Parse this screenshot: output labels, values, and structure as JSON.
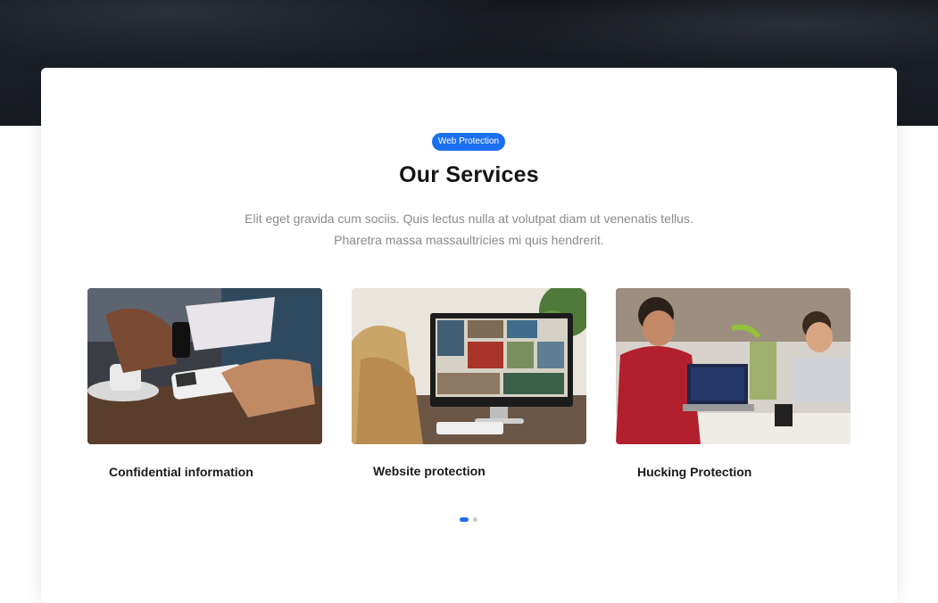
{
  "section": {
    "badge": "Web Protection",
    "title": "Our Services",
    "subtitle_line1": "Elit eget gravida cum sociis. Quis lectus nulla at volutpat diam ut venenatis tellus.",
    "subtitle_line2": "Pharetra massa massaultricies mi quis hendrerit."
  },
  "services": [
    {
      "label": "Confidential information",
      "image": "payment-terminal-photo"
    },
    {
      "label": "Website protection",
      "image": "computer-monitor-photo"
    },
    {
      "label": "Hucking Protection",
      "image": "people-with-laptops-photo"
    }
  ],
  "carousel": {
    "active_index": 0,
    "total": 2
  },
  "colors": {
    "accent": "#1d6ff2",
    "hero_bg": "#171a21",
    "title": "#141414",
    "subtitle": "#8a8a8a"
  }
}
